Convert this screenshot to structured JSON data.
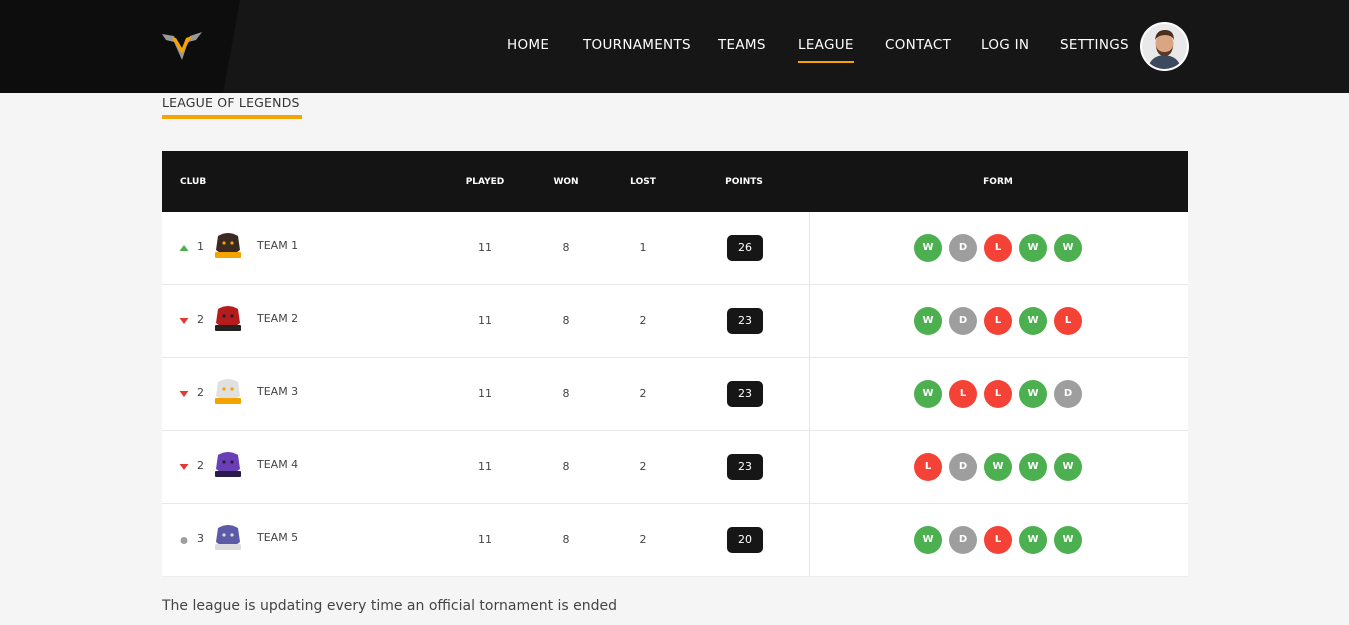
{
  "nav": {
    "items": [
      {
        "label": "HOME",
        "active": false
      },
      {
        "label": "TOURNAMENTS",
        "active": false
      },
      {
        "label": "TEAMS",
        "active": false
      },
      {
        "label": "LEAGUE",
        "active": true
      },
      {
        "label": "CONTACT",
        "active": false
      },
      {
        "label": "LOG IN",
        "active": false
      },
      {
        "label": "SETTINGS",
        "active": false
      }
    ]
  },
  "section": {
    "title": "LEAGUE OF LEGENDS"
  },
  "table": {
    "headers": {
      "club": "CLUB",
      "played": "PLAYED",
      "won": "WON",
      "lost": "LOST",
      "points": "POINTS",
      "form": "FORM"
    },
    "rows": [
      {
        "trend": "up",
        "rank": "1",
        "logo": "panthers-logo",
        "team": "TEAM 1",
        "played": "11",
        "won": "8",
        "lost": "1",
        "points": "26",
        "form": [
          "W",
          "D",
          "L",
          "W",
          "W"
        ]
      },
      {
        "trend": "down",
        "rank": "2",
        "logo": "vikings-logo",
        "team": "TEAM 2",
        "played": "11",
        "won": "8",
        "lost": "2",
        "points": "23",
        "form": [
          "W",
          "D",
          "L",
          "W",
          "L"
        ]
      },
      {
        "trend": "down",
        "rank": "2",
        "logo": "eagles-logo",
        "team": "TEAM 3",
        "played": "11",
        "won": "8",
        "lost": "2",
        "points": "23",
        "form": [
          "W",
          "L",
          "L",
          "W",
          "D"
        ]
      },
      {
        "trend": "down",
        "rank": "2",
        "logo": "reapers-logo",
        "team": "TEAM 4",
        "played": "11",
        "won": "8",
        "lost": "2",
        "points": "23",
        "form": [
          "L",
          "D",
          "W",
          "W",
          "W"
        ]
      },
      {
        "trend": "same",
        "rank": "3",
        "logo": "unicorns-logo",
        "team": "TEAM 5",
        "played": "11",
        "won": "8",
        "lost": "2",
        "points": "20",
        "form": [
          "W",
          "D",
          "L",
          "W",
          "W"
        ]
      }
    ]
  },
  "footnote": "The league is updating every time an official tornament is ended",
  "colors": {
    "accent": "#f5a300",
    "header_bg": "#161616",
    "win": "#4caf50",
    "draw": "#9e9e9e",
    "loss": "#f44336",
    "trend_up": "#4caf50",
    "trend_down": "#e53935",
    "trend_same": "#9e9e9e"
  }
}
